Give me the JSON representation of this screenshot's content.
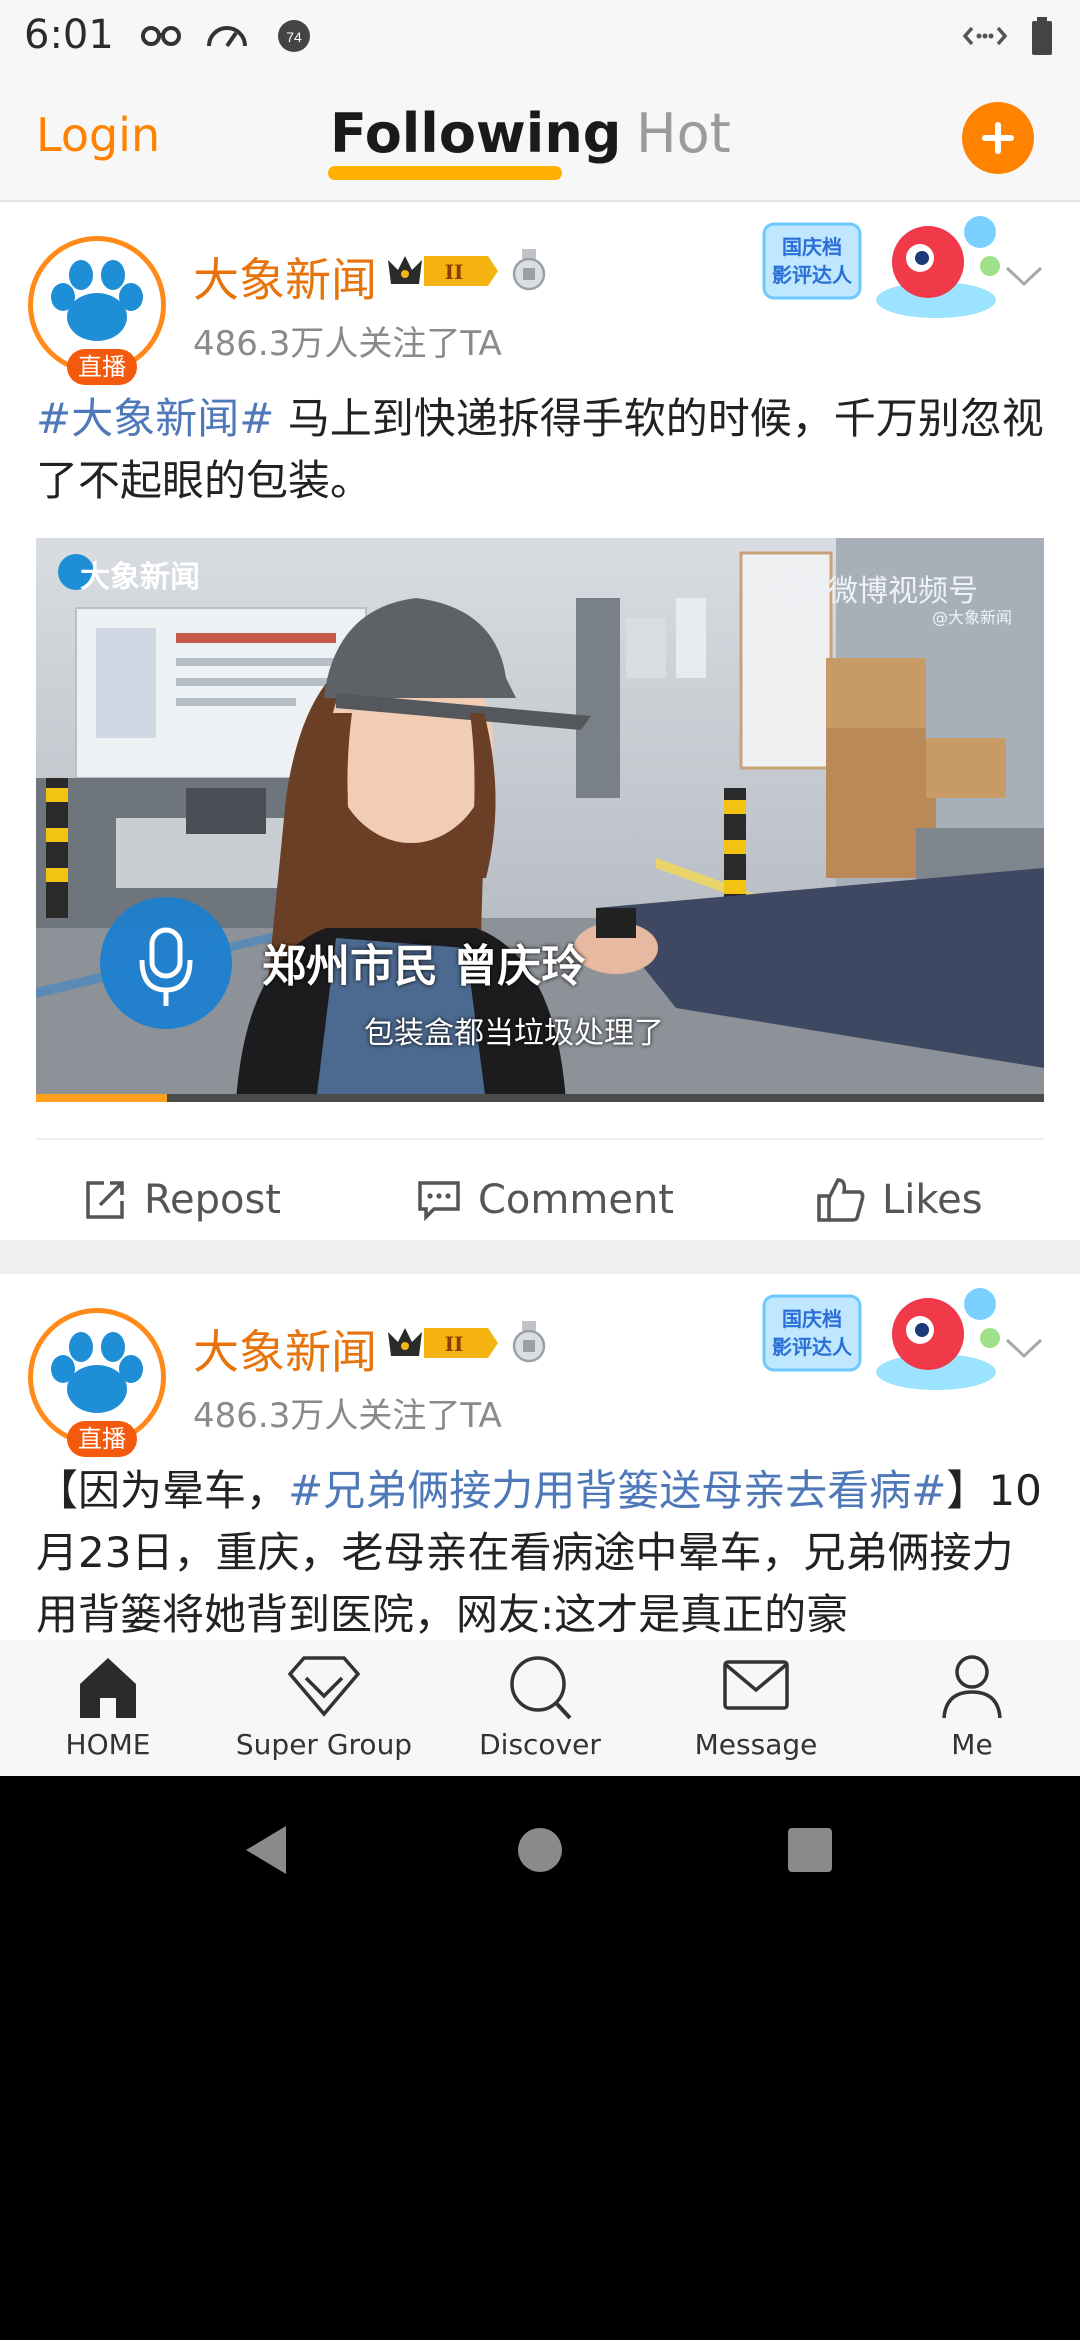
{
  "status_bar": {
    "time": "6:01",
    "battery_level": 0.9,
    "notification_badge": "74"
  },
  "top_nav": {
    "login_label": "Login",
    "tabs": [
      {
        "label": "Following",
        "active": true
      },
      {
        "label": "Hot",
        "active": false
      }
    ],
    "add_icon": "plus-icon"
  },
  "posts": [
    {
      "author": "大象新闻",
      "followers": "486.3万人关注了TA",
      "live_badge": "直播",
      "vip_level": "II",
      "sticker": [
        "国庆档",
        "影评达人"
      ],
      "hashtag": "#大象新闻#",
      "text": " 马上到快递拆得手软的时候，千万别忽视了不起眼的包装。",
      "video": {
        "logo": "大象新闻",
        "watermark": "微博视频号",
        "watermark_sub": "@大象新闻",
        "caption_name": "郑州市民 曾庆玲",
        "caption_quote": "包装盒都当垃圾处理了",
        "progress": 0.13
      },
      "actions": {
        "repost": "Repost",
        "comment": "Comment",
        "likes": "Likes"
      }
    },
    {
      "author": "大象新闻",
      "followers": "486.3万人关注了TA",
      "live_badge": "直播",
      "vip_level": "II",
      "sticker": [
        "国庆档",
        "影评达人"
      ],
      "text_prefix": "【因为晕车，",
      "hashtag": "#兄弟俩接力用背篓送母亲去看病#",
      "text_suffix": "】10月23日，重庆，老母亲在看病途中晕车，兄弟俩接力用背篓将她背到医院，网友:这才是真正的豪"
    }
  ],
  "bottom_nav": [
    {
      "label": "HOME",
      "icon": "home-icon"
    },
    {
      "label": "Super Group",
      "icon": "diamond-icon"
    },
    {
      "label": "Discover",
      "icon": "search-icon"
    },
    {
      "label": "Message",
      "icon": "envelope-icon"
    },
    {
      "label": "Me",
      "icon": "person-icon"
    }
  ],
  "colors": {
    "accent": "#ff8200",
    "hashtag": "#4e78b8",
    "author": "#e8730b"
  }
}
